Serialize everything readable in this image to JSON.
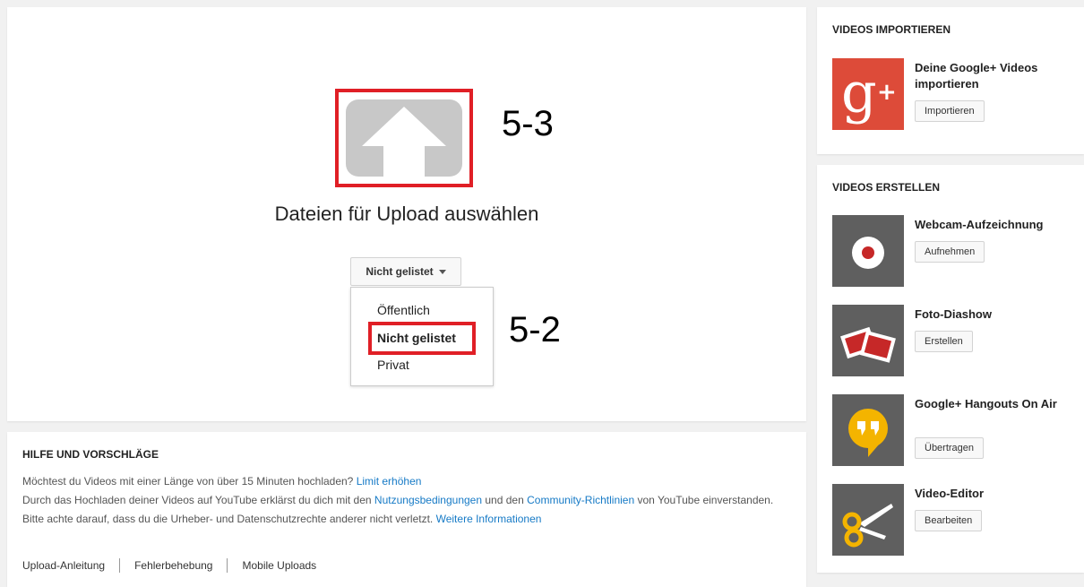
{
  "upload": {
    "title": "Dateien für Upload auswählen",
    "privacy_selected": "Nicht gelistet",
    "privacy_options": [
      "Öffentlich",
      "Nicht gelistet",
      "Privat"
    ],
    "annotation_top": "5-3",
    "annotation_bottom": "5-2"
  },
  "help": {
    "title": "HILFE UND VORSCHLÄGE",
    "line1": "Möchtest du Videos mit einer Länge von über 15 Minuten hochladen?",
    "line1_link": "Limit erhöhen",
    "line2_a": "Durch das Hochladen deiner Videos auf YouTube erklärst du dich mit den",
    "line2_link1": "Nutzungsbedingungen",
    "line2_b": "und den",
    "line2_link2": "Community-Richtlinien",
    "line2_c": "von YouTube einverstanden.",
    "line3": "Bitte achte darauf, dass du die Urheber- und Datenschutzrechte anderer nicht verletzt.",
    "line3_link": "Weitere Informationen",
    "links": [
      "Upload-Anleitung",
      "Fehlerbehebung",
      "Mobile Uploads"
    ]
  },
  "import": {
    "title": "VIDEOS IMPORTIEREN",
    "item_label": "Deine Google+ Videos importieren",
    "item_button": "Importieren",
    "item_icon": "google-plus-icon"
  },
  "create": {
    "title": "VIDEOS ERSTELLEN",
    "items": [
      {
        "label": "Webcam-Aufzeichnung",
        "button": "Aufnehmen",
        "icon": "record-icon"
      },
      {
        "label": "Foto-Diashow",
        "button": "Erstellen",
        "icon": "photos-icon"
      },
      {
        "label": "Google+ Hangouts On Air",
        "button": "Übertragen",
        "icon": "hangouts-icon"
      },
      {
        "label": "Video-Editor",
        "button": "Bearbeiten",
        "icon": "scissors-icon"
      }
    ]
  },
  "colors": {
    "highlight": "#e01f26",
    "link": "#167ac6",
    "gplus": "#dd4b39",
    "hangouts": "#f4b400"
  }
}
